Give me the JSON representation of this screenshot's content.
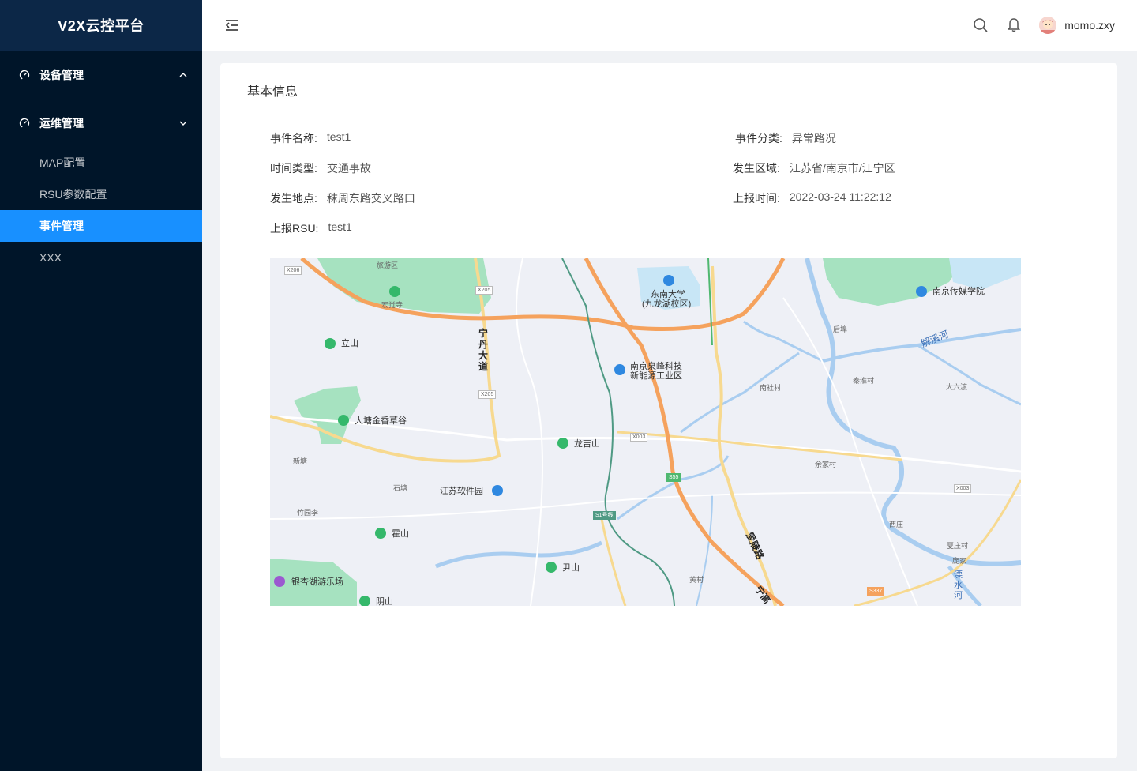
{
  "app": {
    "title": "V2X云控平台"
  },
  "sidebar": {
    "groups": [
      {
        "label": "设备管理",
        "icon": "dashboard-icon",
        "expanded": false
      },
      {
        "label": "运维管理",
        "icon": "dashboard-icon",
        "expanded": true,
        "items": [
          {
            "label": "MAP配置",
            "active": false
          },
          {
            "label": "RSU参数配置",
            "active": false
          },
          {
            "label": "事件管理",
            "active": true
          },
          {
            "label": "XXX",
            "active": false
          }
        ]
      }
    ]
  },
  "header": {
    "icons": [
      "menu-fold-icon",
      "search-icon",
      "bell-icon"
    ],
    "user": {
      "name": "momo.zxy"
    }
  },
  "card": {
    "title": "基本信息",
    "fields": {
      "event_name": {
        "label": "事件名称:",
        "value": "test1"
      },
      "event_category": {
        "label": "事件分类:",
        "value": "异常路况"
      },
      "time_type": {
        "label": "时间类型:",
        "value": "交通事故"
      },
      "region": {
        "label": "发生区域:",
        "value": "江苏省/南京市/江宁区"
      },
      "location": {
        "label": "发生地点:",
        "value": "秣周东路交叉路口"
      },
      "report_time": {
        "label": "上报时间:",
        "value": "2022-03-24 11:22:12"
      },
      "report_rsu": {
        "label": "上报RSU:",
        "value": "test1"
      }
    }
  },
  "map": {
    "labels": {
      "lvyouqu": "旅游区",
      "hongjuesi": "宏觉寺",
      "lishan": "立山",
      "ningdan": "宁丹大道",
      "dongnan": "东南大学",
      "jiulonghu": "(九龙湖校区)",
      "nanchuan": "南京传媒学院",
      "houbu": "后埠",
      "xiexihe": "解溪河",
      "quanfeng1": "南京泉峰科技",
      "quanfeng2": "新能源工业区",
      "nanshecun": "南社村",
      "qinhuaicun": "秦淮村",
      "daliudu": "大六渡",
      "datang": "大塘金香草谷",
      "xintang": "新塘",
      "longjishan": "龙吉山",
      "yujiacun": "余家村",
      "shitang": "石塘",
      "ruanjianyuan": "江苏软件园",
      "zhuyuanli": "竹园李",
      "s1": "S1号线",
      "xizhuang": "西庄",
      "huoshan": "霍山",
      "qinglinglu": "爱陵路",
      "xiazhuangcun": "夏庄村",
      "pangjia": "庞家",
      "lishuihe": "溧水河",
      "yinshan": "尹山",
      "huangcun": "黄村",
      "yinxinghu": "银杏湖游乐场",
      "yinshan2": "阴山",
      "x206": "X206",
      "x205a": "X205",
      "x205b": "X205",
      "x003a": "X003",
      "x003b": "X003",
      "s55": "S55",
      "s337": "S337",
      "ninggao": "宁高"
    }
  },
  "colors": {
    "sidebar_bg": "#001529",
    "brand_bg": "#0c2747",
    "active_item": "#1890ff",
    "page_bg": "#f0f2f5",
    "highway": "#f5a25d",
    "water": "#a9cdf0",
    "park": "#a6e2c0"
  }
}
